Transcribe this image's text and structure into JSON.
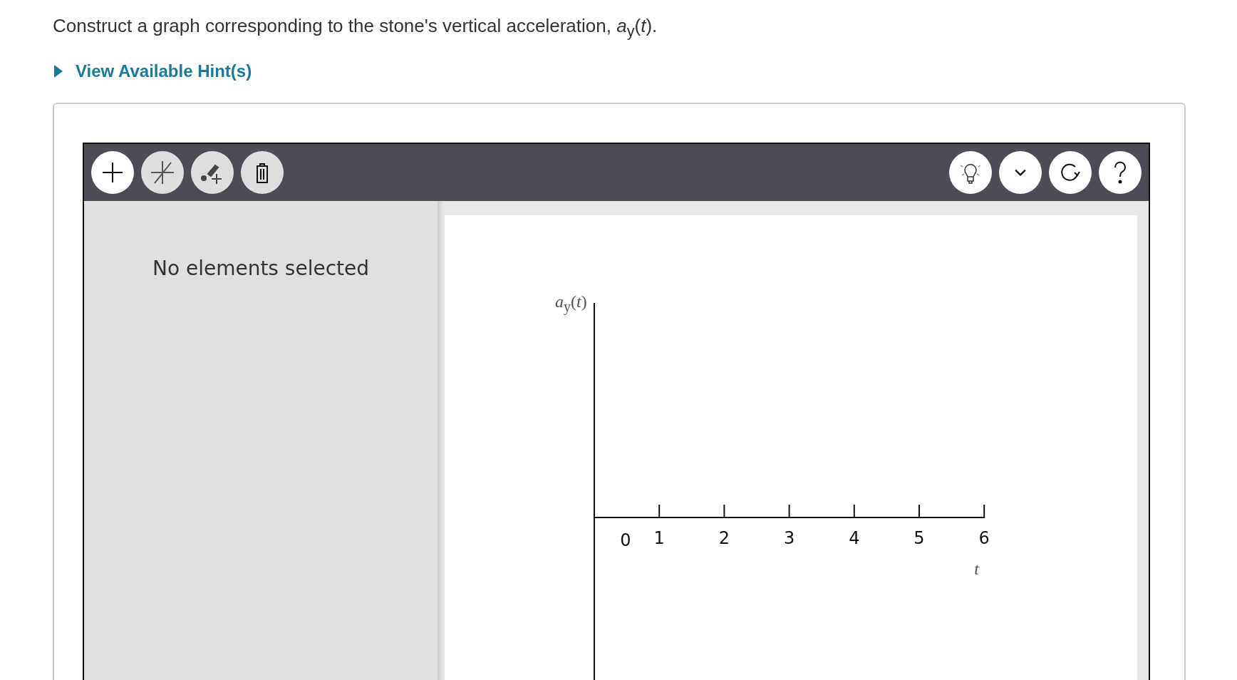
{
  "prompt": "Construct a graph corresponding to the stone's vertical acceleration, *a*$_{y}$(*t*).",
  "hint": {
    "label": "View Available Hint(s)",
    "expanded": false
  },
  "toolbar": {
    "left_tools": [
      {
        "kind": "point",
        "selected": true
      },
      {
        "kind": "line",
        "selected": false
      },
      {
        "kind": "draw",
        "selected": false
      },
      {
        "kind": "delete",
        "selected": false
      }
    ],
    "right_tools": [
      {
        "kind": "hint"
      },
      {
        "kind": "menu"
      },
      {
        "kind": "reset"
      },
      {
        "kind": "help"
      }
    ]
  },
  "side_panel": {
    "message": "No elements selected"
  },
  "graph": {
    "x_axis_label": "*t*",
    "y_axis_label": "*a*$_{y}$(*t*)",
    "tick_labels": [
      "0",
      "1",
      "2",
      "3",
      "4",
      "5",
      "6"
    ]
  }
}
